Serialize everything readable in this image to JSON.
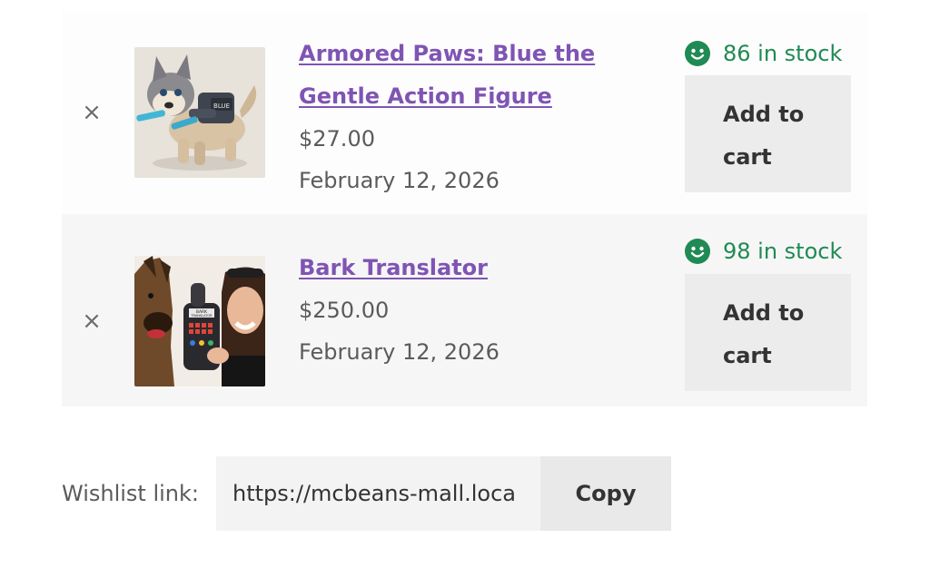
{
  "items": [
    {
      "remove_glyph": "×",
      "title_line1": "Armored Paws: Blue the",
      "title_line2": "Gentle Action Figure",
      "price": "$27.00",
      "date": "February 12, 2026",
      "stock": "86 in stock",
      "cart_line1": "Add to",
      "cart_line2": "cart",
      "image_text": "BLUE"
    },
    {
      "remove_glyph": "×",
      "title_line1": "Bark Translator",
      "price": "$250.00",
      "date": "February 12, 2026",
      "stock": "98 in stock",
      "cart_line1": "Add to",
      "cart_line2": "cart",
      "image_text_1": "BARK",
      "image_text_2": "TRANSLATOR"
    }
  ],
  "share": {
    "label": "Wishlist link:",
    "url": "https://mcbeans-mall.loca",
    "copy_label": "Copy"
  },
  "colors": {
    "link": "#7f54b3",
    "stock": "#1f8a54"
  },
  "icons": {
    "remove": "close-icon",
    "stock": "smile-icon"
  }
}
